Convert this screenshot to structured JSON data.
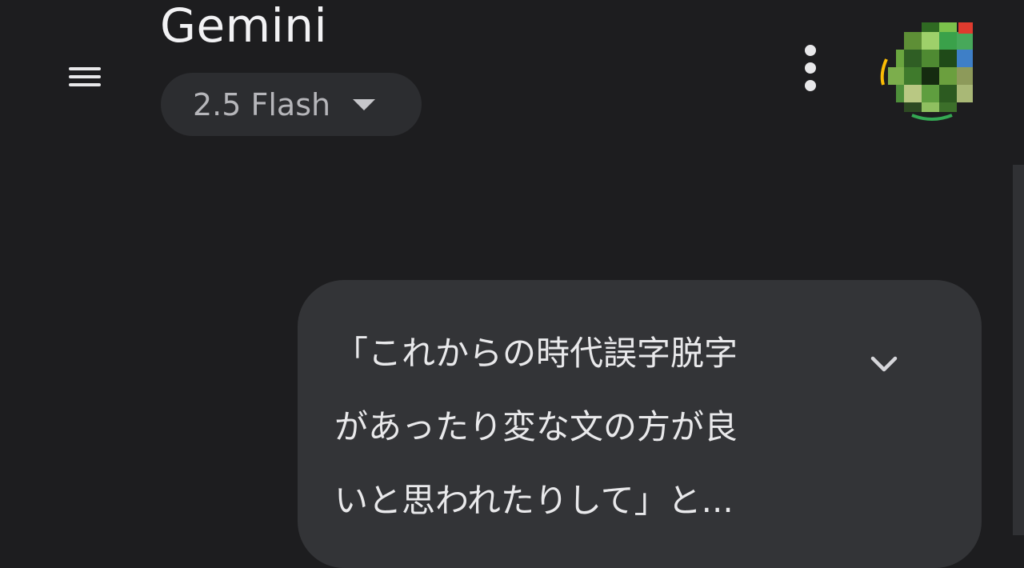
{
  "header": {
    "title": "Gemini",
    "model_selector": {
      "label": "2.5 Flash",
      "icon": "dropdown-arrow-icon"
    },
    "menu_icon": "hamburger-menu-icon",
    "more_icon": "more-vertical-icon",
    "avatar_icon": "user-avatar-icon"
  },
  "conversation": {
    "user_message": {
      "lines": [
        "「これからの時代誤字脱字",
        "があったり変な文の方が良",
        "いと思われたりして」と..."
      ],
      "expand_icon": "chevron-down-icon"
    }
  },
  "colors": {
    "background": "#1d1d1f",
    "chip_background": "#2c2d30",
    "bubble_background": "#333437",
    "text_primary": "#e9e9eb",
    "text_secondary": "#b6b6ba"
  }
}
